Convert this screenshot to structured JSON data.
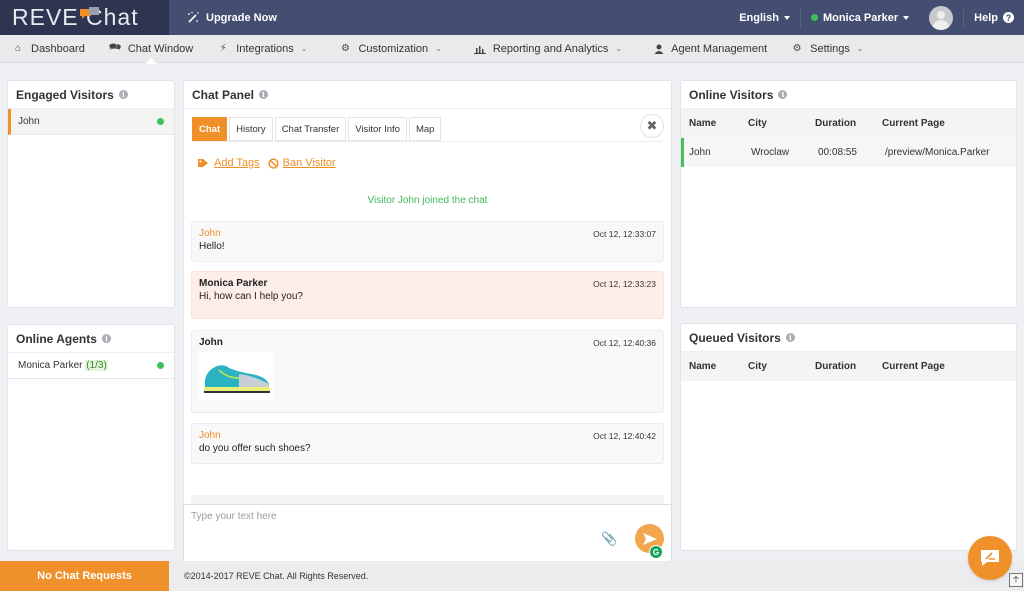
{
  "app": {
    "logo_text": "REVE Chat",
    "upgrade_label": "Upgrade Now",
    "language": "English",
    "user_name": "Monica Parker",
    "user_status": "online",
    "help_label": "Help"
  },
  "nav": {
    "items": [
      {
        "label": "Dashboard",
        "icon": "home-icon",
        "dropdown": false
      },
      {
        "label": "Chat Window",
        "icon": "chat-icon",
        "dropdown": false,
        "active": true
      },
      {
        "label": "Integrations",
        "icon": "plug-icon",
        "dropdown": true
      },
      {
        "label": "Customization",
        "icon": "gear-icon",
        "dropdown": true
      },
      {
        "label": "Reporting and Analytics",
        "icon": "bar-chart-icon",
        "dropdown": true
      },
      {
        "label": "Agent Management",
        "icon": "user-icon",
        "dropdown": false
      },
      {
        "label": "Settings",
        "icon": "gears-icon",
        "dropdown": true
      }
    ]
  },
  "engaged_visitors": {
    "title": "Engaged Visitors",
    "items": [
      {
        "name": "John",
        "status": "online"
      }
    ]
  },
  "online_agents": {
    "title": "Online Agents",
    "items": [
      {
        "name": "Monica Parker",
        "ratio": "(1/3)",
        "status": "online"
      }
    ]
  },
  "chat_panel": {
    "title": "Chat Panel",
    "tabs": [
      "Chat",
      "History",
      "Chat Transfer",
      "Visitor Info",
      "Map"
    ],
    "active_tab": "Chat",
    "actions": {
      "add_tags": "Add Tags",
      "ban_visitor": "Ban Visitor"
    },
    "system_message": "Visitor John joined the chat",
    "messages": [
      {
        "sender": "John",
        "type": "visitor",
        "text": "Hello!",
        "time": "Oct 12, 12:33:07"
      },
      {
        "sender": "Monica Parker",
        "type": "agent",
        "text": "Hi, how can I help you?",
        "time": "Oct 12, 12:33:23"
      },
      {
        "sender": "John",
        "type": "visitor-image",
        "text": "",
        "attachment": "shoe-image",
        "time": "Oct 12, 12:40:36"
      },
      {
        "sender": "John",
        "type": "visitor",
        "text": "do you offer such shoes?",
        "time": "Oct 12, 12:40:42"
      }
    ],
    "composer_placeholder": "Type your text here"
  },
  "online_visitors": {
    "title": "Online Visitors",
    "columns": [
      "Name",
      "City",
      "Duration",
      "Current Page"
    ],
    "rows": [
      {
        "name": "John",
        "city": "Wroclaw",
        "duration": "00:08:55",
        "page": "/preview/Monica.Parker"
      }
    ]
  },
  "queued_visitors": {
    "title": "Queued Visitors",
    "columns": [
      "Name",
      "City",
      "Duration",
      "Current Page"
    ],
    "rows": []
  },
  "footer": {
    "no_chat_requests": "No Chat Requests",
    "copyright": "©2014-2017 REVE Chat. All Rights Reserved."
  },
  "colors": {
    "accent": "#f0902a",
    "topbar": "#434e70",
    "logo_bg": "#2e3551",
    "online": "#3ec15c"
  }
}
